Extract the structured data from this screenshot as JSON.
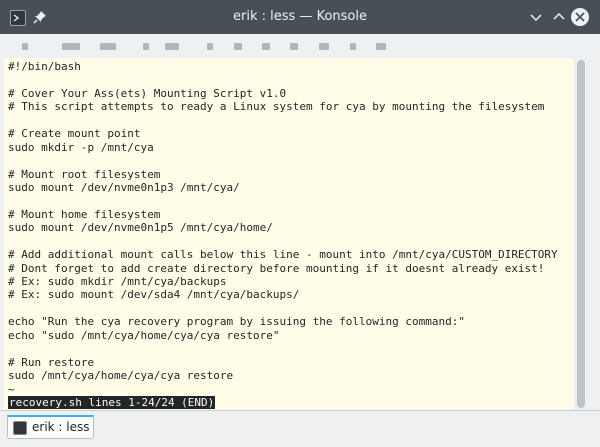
{
  "window": {
    "title": "erik : less — Konsole"
  },
  "terminal": {
    "lines": [
      "#!/bin/bash",
      "",
      "# Cover Your Ass(ets) Mounting Script v1.0",
      "# This script attempts to ready a Linux system for cya by mounting the filesystem",
      "",
      "# Create mount point",
      "sudo mkdir -p /mnt/cya",
      "",
      "# Mount root filesystem",
      "sudo mount /dev/nvme0n1p3 /mnt/cya/",
      "",
      "# Mount home filesystem",
      "sudo mount /dev/nvme0n1p5 /mnt/cya/home/",
      "",
      "# Add additional mount calls below this line - mount into /mnt/cya/CUSTOM_DIRECTORY",
      "# Dont forget to add create directory before mounting if it doesnt already exist!",
      "# Ex: sudo mkdir /mnt/cya/backups",
      "# Ex: sudo mount /dev/sda4 /mnt/cya/backups/",
      "",
      "echo \"Run the cya recovery program by issuing the following command:\"",
      "echo \"sudo /mnt/cya/home/cya/cya restore\"",
      "",
      "# Run restore",
      "sudo /mnt/cya/home/cya/cya restore",
      "~"
    ],
    "status": "recovery.sh lines 1-24/24 (END)"
  },
  "tabs": [
    {
      "label": "erik : less"
    }
  ],
  "colors": {
    "titlebar": "#475057",
    "terminal_bg": "#fffde7",
    "terminal_fg": "#232627",
    "accent": "#3daee9"
  }
}
